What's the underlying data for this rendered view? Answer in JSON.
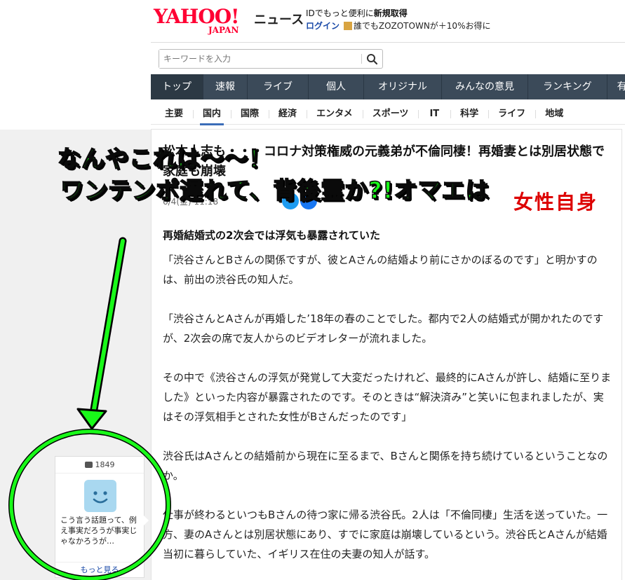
{
  "header": {
    "logo_main": "YAHOO!",
    "logo_sub": "JAPAN",
    "section": "ニュース",
    "promo_prefix": "IDでもっと便利に",
    "promo_link": "新規取得",
    "login": "ログイン",
    "zozo_text": "誰でもZOZOTOWNが＋10%お得に"
  },
  "search": {
    "placeholder": "キーワードを入力"
  },
  "nav": {
    "items": [
      "トップ",
      "速報",
      "ライブ",
      "個人",
      "オリジナル",
      "みんなの意見",
      "ランキング",
      "有"
    ]
  },
  "subnav": {
    "items": [
      "主要",
      "国内",
      "国際",
      "経済",
      "エンタメ",
      "スポーツ",
      "IT",
      "科学",
      "ライフ",
      "地域"
    ]
  },
  "article": {
    "title": "松本人志も・・・コロナ対策権威の元義弟が不倫同棲！再婚妻とは別居状態で家庭も崩壊",
    "meta": "6/4(金) 11:18",
    "publisher_logo": "女性自身",
    "heading": "再婚結婚式の2次会では浮気も暴露されていた",
    "paragraphs": [
      "「渋谷さんとBさんの関係ですが、彼とAさんの結婚より前にさかのぼるのです」と明かすのは、前出の渋谷氏の知人だ。",
      "「渋谷さんとAさんが再婚した’18年の春のことでした。都内で2人の結婚式が開かれたのですが、2次会の席で友人からのビデオレターが流れました。",
      "その中で《渋谷さんの浮気が発覚して大変だったけれど、最終的にAさんが許し、結婚に至りました》といった内容が暴露されたのです。そのときは“解決済み”と笑いに包まれましたが、実はその浮気相手とされた女性がBさんだったのです」",
      "渋谷氏はAさんとの結婚前から現在に至るまで、Bさんと関係を持ち続けているということなのか。",
      "仕事が終わるといつもBさんの待つ家に帰る渋谷氏。2人は「不倫同棲」生活を送っていた。一方、妻のAさんとは別居状態にあり、すでに家庭は崩壊しているという。渋谷氏とAさんが結婚当初に暮らしていた、イギリス在住の夫妻の知人が話す。"
    ]
  },
  "comments": {
    "count": "1849",
    "preview": "こう言う話題って、例え事実だろうが事実じゃなかろうが…",
    "more": "もっと見る"
  },
  "annotation": {
    "line1": "なんやこれは～～！",
    "line2": "ワンテンポ遅れて、背後霊か?!オマエは",
    "color": "#19f919"
  }
}
